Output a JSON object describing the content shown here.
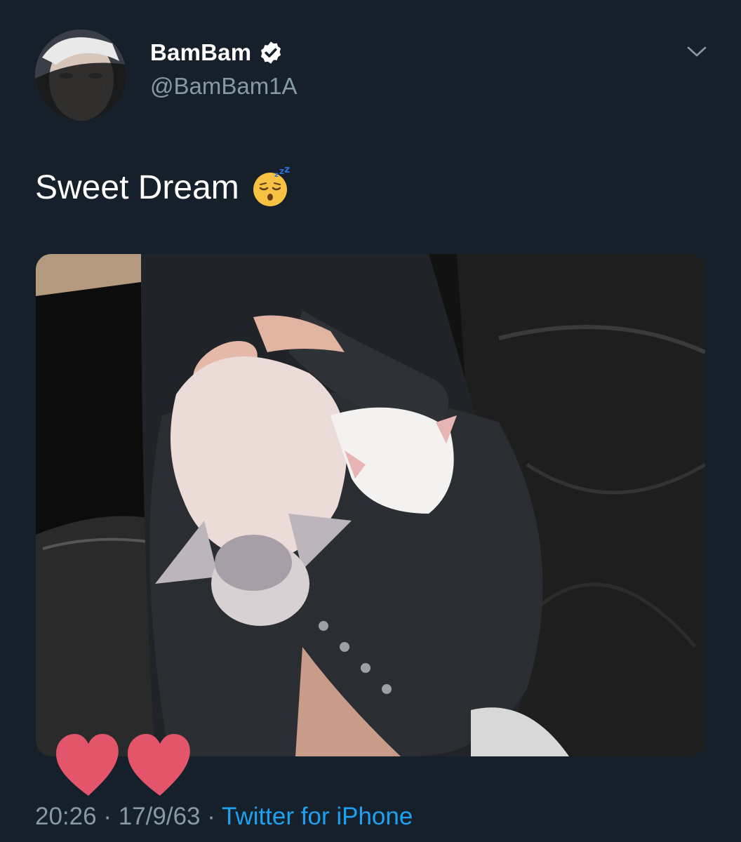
{
  "tweet": {
    "display_name": "BamBam",
    "handle": "@BamBam1A",
    "text": "Sweet Dream",
    "text_emoji": "sleeping-face-emoji",
    "time": "20:26",
    "date": "17/9/63",
    "separator": "·",
    "source": "Twitter for iPhone",
    "verified": true
  },
  "icons": {
    "verified": "verified-badge-icon",
    "menu": "chevron-down-icon",
    "decoration": "red-heart-stickers"
  },
  "colors": {
    "background": "#15202b",
    "secondary_text": "#8899a6",
    "link": "#1da1f2",
    "heart": "#e3556b"
  }
}
